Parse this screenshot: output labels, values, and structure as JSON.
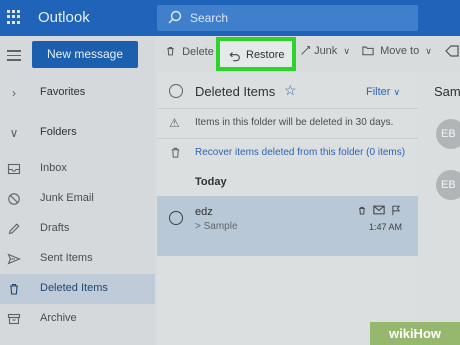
{
  "header": {
    "app_title": "Outlook",
    "search_placeholder": "Search",
    "bar_color": "#1f64b8"
  },
  "left": {
    "new_message": "New message",
    "favorites": "Favorites",
    "folders": "Folders",
    "items": [
      {
        "label": "Inbox",
        "icon": "inbox-icon"
      },
      {
        "label": "Junk Email",
        "icon": "block-icon"
      },
      {
        "label": "Drafts",
        "icon": "pencil-icon"
      },
      {
        "label": "Sent Items",
        "icon": "send-icon"
      },
      {
        "label": "Deleted Items",
        "icon": "trash-icon",
        "selected": true
      },
      {
        "label": "Archive",
        "icon": "archive-icon"
      }
    ]
  },
  "toolbar": {
    "delete": "Delete",
    "restore": "Restore",
    "junk": "Junk",
    "move_to": "Move to"
  },
  "list": {
    "title": "Deleted Items",
    "filter": "Filter",
    "notice": "Items in this folder will be deleted in 30 days.",
    "recover": "Recover items deleted from this folder (0 items)",
    "group": "Today",
    "message": {
      "sender": "edz",
      "subject": "> Sample",
      "time": "1:47 AM"
    }
  },
  "reading": {
    "title": "Sam",
    "avatar1": "EB",
    "avatar2": "EB"
  },
  "watermark": "wikiHow",
  "highlight_color": "#2fd42b"
}
